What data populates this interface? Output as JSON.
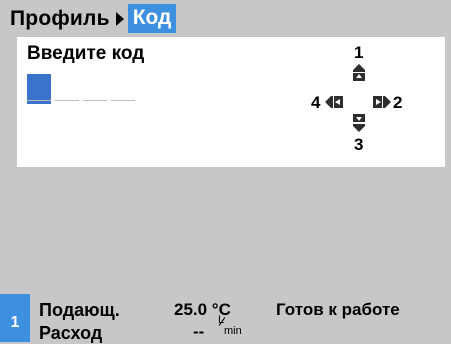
{
  "header": {
    "breadcrumb_root": "Профиль",
    "breadcrumb_current": "Код"
  },
  "panel": {
    "prompt": "Введите код",
    "code_length": 4,
    "active_index": 0
  },
  "nav": {
    "up": "1",
    "right": "2",
    "down": "3",
    "left": "4"
  },
  "status": {
    "channel": "1",
    "supply_label": "Подающ.",
    "supply_value": "25.0 °C",
    "flow_label": "Расход",
    "flow_value": "--",
    "flow_unit_top": "L",
    "flow_unit_bottom": "min",
    "state": "Готов к работе"
  },
  "colors": {
    "accent": "#3d8fe0",
    "active_cell": "#3a72cc",
    "background": "#c7c7c7",
    "panel": "#ffffff"
  }
}
